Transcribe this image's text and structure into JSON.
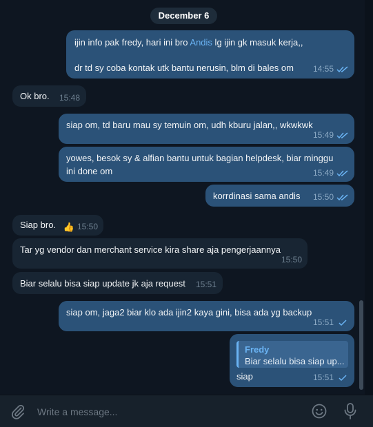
{
  "date_separator": "December 6",
  "messages": [
    {
      "lines": [
        "ijin info pak fredy, hari ini bro ",
        "Andis",
        " lg ijin gk masuk kerja,,"
      ],
      "line2": "dr td sy coba kontak utk bantu nerusin, blm di bales om",
      "time": "14:55"
    },
    {
      "text": "Ok bro.",
      "time": "15:48"
    },
    {
      "text": "siap om, td baru mau sy temuin om, udh kburu jalan,, wkwkwk",
      "time": "15:49"
    },
    {
      "line1": "yowes, besok sy & alfian bantu untuk bagian helpdesk, biar minggu",
      "line2": "ini done om",
      "time": "15:49"
    },
    {
      "text": "korrdinasi sama andis",
      "time": "15:50"
    },
    {
      "text": "Siap bro.",
      "reaction": "👍",
      "time": "15:50"
    },
    {
      "text": "Tar yg vendor dan merchant service kira share aja pengerjaannya",
      "time": "15:50"
    },
    {
      "text": "Biar selalu bisa siap update jk aja request",
      "time": "15:51"
    },
    {
      "text": "siap om, jaga2 biar klo ada ijin2 kaya gini, bisa ada yg backup",
      "time": "15:51"
    },
    {
      "reply_name": "Fredy",
      "reply_text": "Biar selalu bisa siap up...",
      "text": "siap",
      "time": "15:51"
    }
  ],
  "composer": {
    "placeholder": "Write a message..."
  },
  "icons": {
    "attach": "paperclip-icon",
    "emoji": "emoji-icon",
    "voice": "microphone-icon",
    "read": "double-check-icon",
    "sent": "single-check-icon"
  },
  "colors": {
    "background": "#0e1621",
    "outgoing": "#2b5278",
    "incoming": "#182533",
    "link": "#6ab3f3"
  }
}
